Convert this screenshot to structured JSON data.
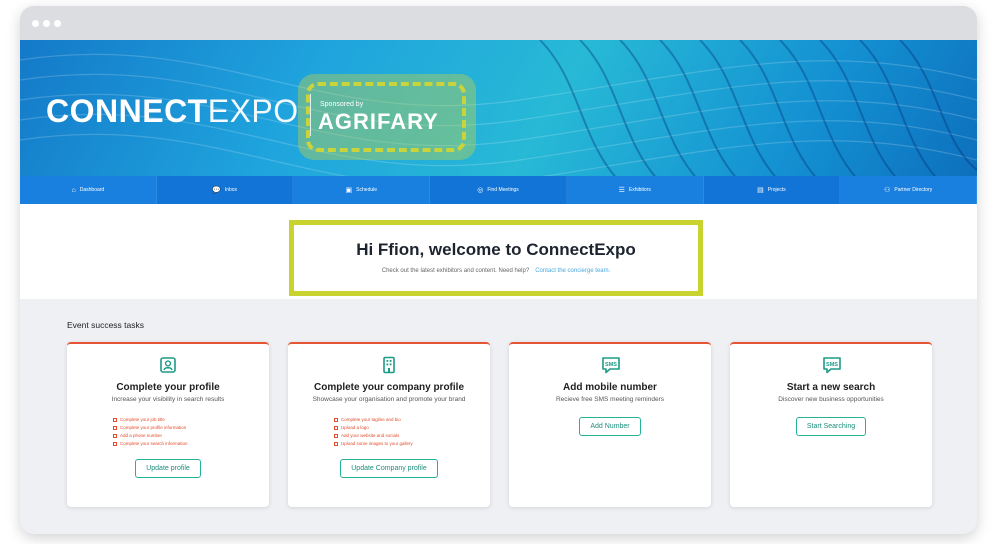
{
  "brand": {
    "name_bold": "CONNECT",
    "name_light": "EXPO",
    "sponsored_by": "Sponsored by",
    "sponsor": "AGRIFARY"
  },
  "nav": [
    {
      "label": "Dashboard",
      "icon": "home-icon"
    },
    {
      "label": "Inbox",
      "icon": "chat-icon"
    },
    {
      "label": "Schedule",
      "icon": "calendar-icon"
    },
    {
      "label": "Find Meetings",
      "icon": "globe-icon"
    },
    {
      "label": "Exhibitors",
      "icon": "list-icon"
    },
    {
      "label": "Projects",
      "icon": "folder-icon"
    },
    {
      "label": "Partner Directory",
      "icon": "partner-icon"
    }
  ],
  "welcome": {
    "title": "Hi Ffion, welcome to ConnectExpo",
    "subtitle": "Check out the latest exhibitors and content. Need help?",
    "link": "Contact the concierge team."
  },
  "tasks": {
    "heading": "Event success tasks",
    "cards": [
      {
        "icon": "profile-icon",
        "title": "Complete your profile",
        "subtitle": "Increase your visibility in search results",
        "items": [
          "Complete your job title",
          "Complete your profile information",
          "Add a phone number",
          "Complete your search information"
        ],
        "button": "Update profile"
      },
      {
        "icon": "building-icon",
        "title": "Complete your company profile",
        "subtitle": "Showcase your organisation and promote your brand",
        "items": [
          "Complete your tagline and bio",
          "Upload a logo",
          "Add your website and socials",
          "Upload some images to your gallery"
        ],
        "button": "Update Company profile"
      },
      {
        "icon": "sms-icon",
        "title": "Add mobile number",
        "subtitle": "Recieve free SMS meeting reminders",
        "button": "Add Number"
      },
      {
        "icon": "sms-icon",
        "title": "Start a new search",
        "subtitle": "Discover new business opportunities",
        "button": "Start Searching"
      }
    ]
  },
  "colors": {
    "accent": "#1174d6",
    "highlight": "#c8d330",
    "teal": "#25b298",
    "card_top": "#e55535"
  }
}
